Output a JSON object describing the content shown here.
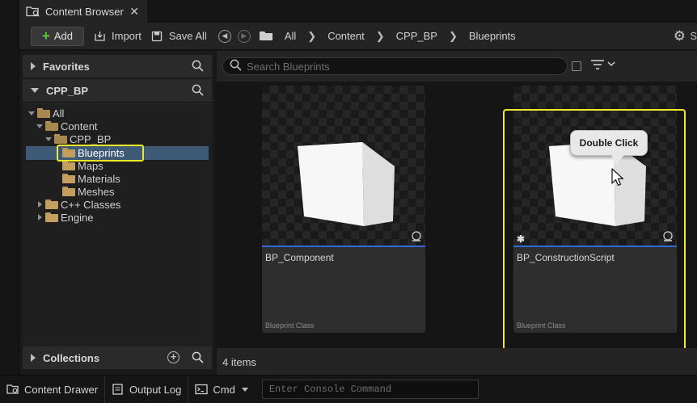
{
  "tab": {
    "title": "Content Browser",
    "close": "✕"
  },
  "toolbar": {
    "add_label": "Add",
    "import_label": "Import",
    "save_all_label": "Save All",
    "breadcrumbs": [
      "All",
      "Content",
      "CPP_BP",
      "Blueprints"
    ],
    "settings_label": "S"
  },
  "sidebar": {
    "favorites": "Favorites",
    "project": "CPP_BP",
    "collections": "Collections",
    "tree": [
      {
        "label": "All",
        "level": 0,
        "expanded": true
      },
      {
        "label": "Content",
        "level": 1,
        "expanded": true
      },
      {
        "label": "CPP_BP",
        "level": 2,
        "expanded": true
      },
      {
        "label": "Blueprints",
        "level": 3,
        "selected": true
      },
      {
        "label": "Maps",
        "level": 3
      },
      {
        "label": "Materials",
        "level": 3
      },
      {
        "label": "Meshes",
        "level": 3
      },
      {
        "label": "C++ Classes",
        "level": 1,
        "expanded": false
      },
      {
        "label": "Engine",
        "level": 1,
        "expanded": false
      }
    ]
  },
  "content": {
    "search_placeholder": "Search Blueprints",
    "assets": [
      {
        "name": "BP_Component",
        "type": "Blueprint Class"
      },
      {
        "name": "BP_ConstructionScript",
        "type": "Blueprint Class"
      }
    ],
    "tooltip": "Double Click",
    "items_count": "4 items"
  },
  "bottom": {
    "content_drawer": "Content Drawer",
    "output_log": "Output Log",
    "cmd": "Cmd",
    "console_placeholder": "Enter Console Command"
  },
  "colors": {
    "highlight": "#f0e82a",
    "selection": "#3f5a76",
    "add_plus": "#5bcb3b",
    "thumb_underline": "#2f6ad8",
    "folder": "#c49e5e"
  }
}
